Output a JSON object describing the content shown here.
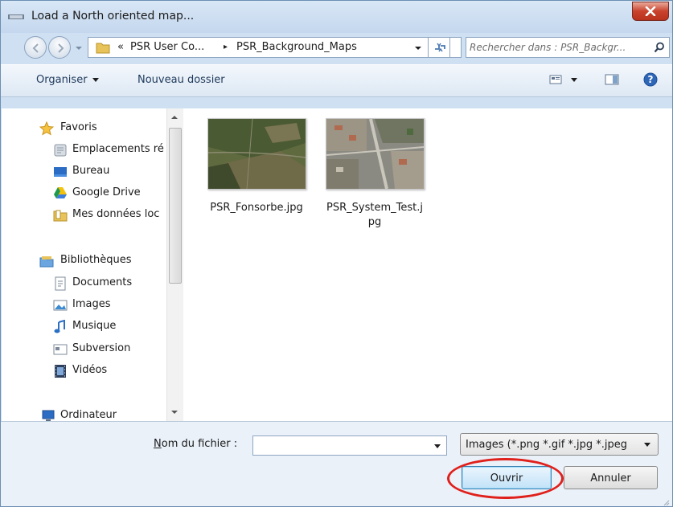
{
  "window": {
    "title": "Load a North oriented map...",
    "close_label": "X"
  },
  "address": {
    "breadcrumbs": [
      "«",
      "PSR User Co...",
      "▸",
      "PSR_Background_Maps"
    ]
  },
  "search": {
    "placeholder": "Rechercher dans : PSR_Backgr..."
  },
  "toolbar": {
    "organize_label": "Organiser",
    "new_folder_label": "Nouveau dossier"
  },
  "nav": {
    "items": [
      {
        "label": "Favoris",
        "icon": "star-icon"
      },
      {
        "label": "Emplacements ré",
        "icon": "recent-places-icon"
      },
      {
        "label": "Bureau",
        "icon": "desktop-icon"
      },
      {
        "label": "Google Drive",
        "icon": "google-drive-icon"
      },
      {
        "label": "Mes données loc",
        "icon": "folder-icon"
      },
      {
        "label": "Bibliothèques",
        "icon": "libraries-icon"
      },
      {
        "label": "Documents",
        "icon": "documents-icon"
      },
      {
        "label": "Images",
        "icon": "images-icon"
      },
      {
        "label": "Musique",
        "icon": "music-icon"
      },
      {
        "label": "Subversion",
        "icon": "subversion-icon"
      },
      {
        "label": "Vidéos",
        "icon": "videos-icon"
      },
      {
        "label": "Ordinateur",
        "icon": "computer-icon"
      }
    ]
  },
  "files": [
    {
      "name": "PSR_Fonsorbe.jpg",
      "icon": "aerial-map-thumbnail"
    },
    {
      "name": "PSR_System_Test.jpg",
      "icon": "aerial-map-thumbnail"
    }
  ],
  "bottom": {
    "filename_label_underlined": "N",
    "filename_label_rest": "om du fichier :",
    "filename_value": "",
    "filter_value": "Images (*.png *.gif *.jpg *.jpeg",
    "open_label": "Ouvrir",
    "cancel_label": "Annuler"
  },
  "colors": {
    "highlight": "#e0201b",
    "accent": "#3c7fb1"
  }
}
